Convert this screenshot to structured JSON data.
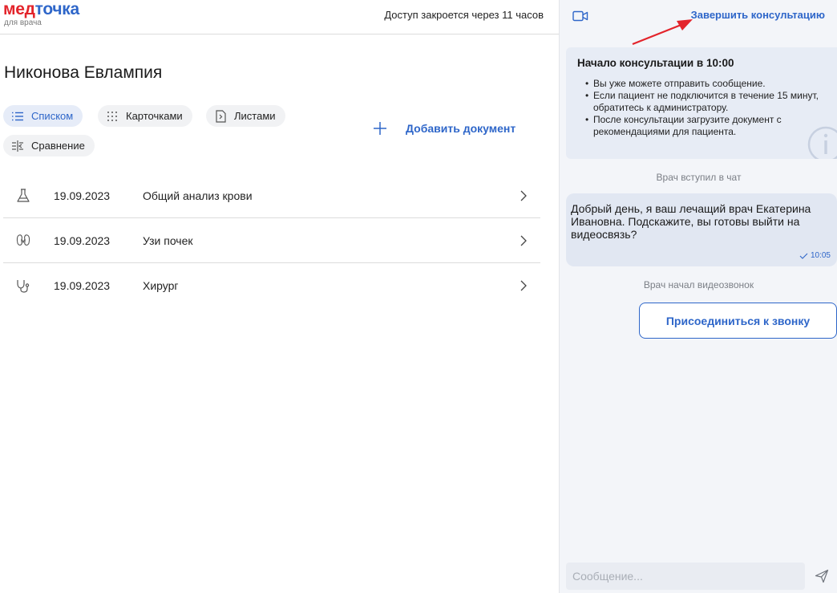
{
  "header": {
    "logo_part1": "мед",
    "logo_part2": "точка",
    "logo_sub": "для врача",
    "access_text": "Доступ закроется через 11 часов"
  },
  "patient": {
    "name": "Никонова Евлампия"
  },
  "view_modes": [
    {
      "label": "Списком",
      "icon": "list-icon",
      "active": true
    },
    {
      "label": "Карточками",
      "icon": "grid-dots-icon",
      "active": false
    },
    {
      "label": "Листами",
      "icon": "document-icon",
      "active": false
    },
    {
      "label": "Сравнение",
      "icon": "compare-icon",
      "active": false
    }
  ],
  "add_document": {
    "label": "Добавить документ",
    "icon": "plus-icon"
  },
  "documents": [
    {
      "date": "19.09.2023",
      "name": "Общий анализ крови",
      "icon": "flask-icon"
    },
    {
      "date": "19.09.2023",
      "name": "Узи почек",
      "icon": "kidneys-icon"
    },
    {
      "date": "19.09.2023",
      "name": "Хирург",
      "icon": "stethoscope-icon"
    }
  ],
  "chat": {
    "video_icon": "video-camera-icon",
    "end_label": "Завершить консультацию",
    "info": {
      "title": "Начало консультации в 10:00",
      "items": [
        "Вы уже можете отправить сообщение.",
        "Если пациент не подключится в течение 15 минут, обратитесь к администратору.",
        "После консультации загрузите документ с рекомендациями для пациента."
      ]
    },
    "system_joined": "Врач вступил в чат",
    "message": {
      "text": "Добрый день, я ваш лечащий врач Екатерина Ивановна. Подскажите, вы готовы выйти на видеосвязь?",
      "time": "10:05"
    },
    "system_video": "Врач начал видеозвонок",
    "join_label": "Присоединиться к звонку",
    "input_placeholder": "Сообщение...",
    "send_icon": "send-icon"
  },
  "colors": {
    "brand_blue": "#2e66c9",
    "brand_red": "#e3242b",
    "annotation_arrow": "#e3242b",
    "chat_bg": "#f3f5f9"
  }
}
